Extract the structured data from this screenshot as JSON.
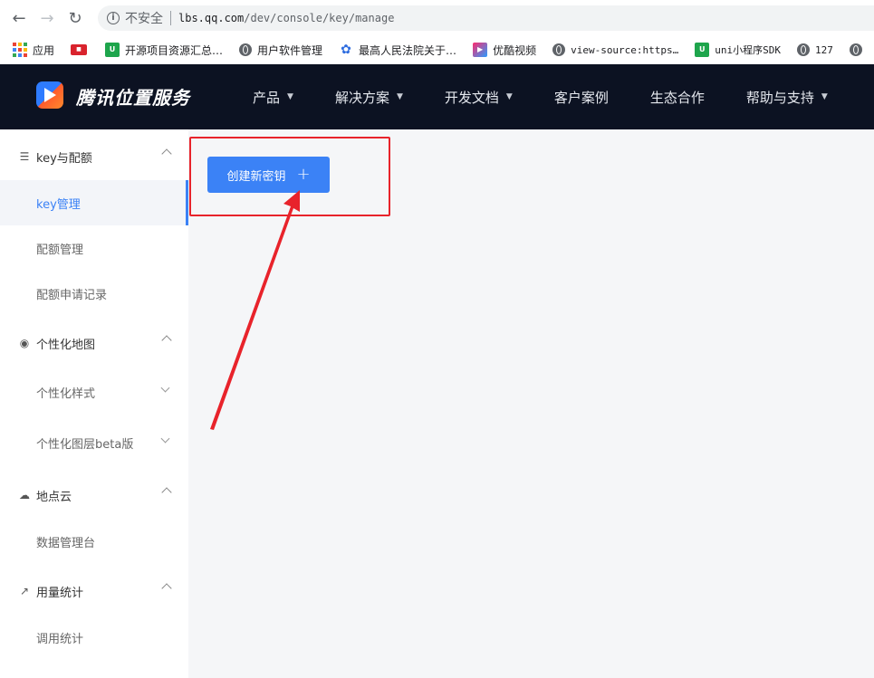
{
  "browser": {
    "insecure_label": "不安全",
    "url_host": "lbs.qq.com",
    "url_path": "/dev/console/key/manage",
    "bookmarks": [
      {
        "label": "应用",
        "icon": "apps-grid-icon"
      },
      {
        "label": "",
        "icon": "red-badge-icon"
      },
      {
        "label": "开源项目资源汇总…",
        "icon": "green-u-icon"
      },
      {
        "label": "用户软件管理",
        "icon": "globe-icon"
      },
      {
        "label": "最高人民法院关于…",
        "icon": "baidu-paw-icon"
      },
      {
        "label": "优酷视频",
        "icon": "youku-icon"
      },
      {
        "label": "view-source:https…",
        "icon": "globe-icon"
      },
      {
        "label": "uni小程序SDK",
        "icon": "green-u-icon"
      },
      {
        "label": "127",
        "icon": "globe-icon"
      }
    ]
  },
  "site": {
    "logo_text": "腾讯位置服务",
    "nav": [
      {
        "label": "产品",
        "has_caret": true
      },
      {
        "label": "解决方案",
        "has_caret": true
      },
      {
        "label": "开发文档",
        "has_caret": true
      },
      {
        "label": "客户案例",
        "has_caret": false
      },
      {
        "label": "生态合作",
        "has_caret": false
      },
      {
        "label": "帮助与支持",
        "has_caret": true
      }
    ]
  },
  "sidebar": {
    "groups": [
      {
        "title": "key与配额",
        "icon": "sliders-icon"
      },
      {
        "title": "个性化地图",
        "icon": "palette-icon"
      },
      {
        "title": "地点云",
        "icon": "cloud-icon"
      },
      {
        "title": "用量统计",
        "icon": "line-chart-icon"
      }
    ],
    "items": [
      {
        "label": "key管理"
      },
      {
        "label": "配额管理"
      },
      {
        "label": "配额申请记录"
      },
      {
        "label": "个性化样式"
      },
      {
        "label": "个性化图层beta版"
      },
      {
        "label": "数据管理台"
      },
      {
        "label": "调用统计"
      }
    ]
  },
  "main": {
    "create_key_label": "创建新密钥",
    "create_key_plus": "+"
  },
  "colors": {
    "accent": "#3b82f6",
    "header_bg": "#0c1222",
    "annotation_red": "#e8232b"
  }
}
